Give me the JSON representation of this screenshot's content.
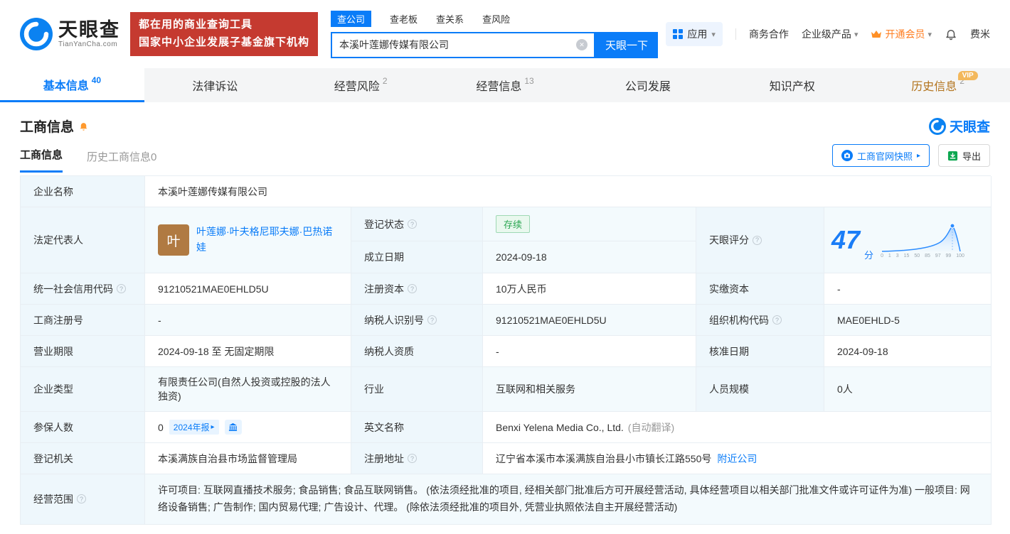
{
  "icons": {
    "caret_down": "▾",
    "arrow_right": "▸",
    "clear": "✕",
    "question": "?"
  },
  "header": {
    "brand": {
      "name": "天眼查",
      "domain": "TianYanCha.com"
    },
    "promo": {
      "line1": "都在用的商业查询工具",
      "line2": "国家中小企业发展子基金旗下机构"
    },
    "search": {
      "tabs": [
        {
          "label": "查公司"
        },
        {
          "label": "查老板"
        },
        {
          "label": "查关系"
        },
        {
          "label": "查风险"
        }
      ],
      "value": "本溪叶莲娜传媒有限公司",
      "button": "天眼一下"
    },
    "menu": {
      "apps": "应用",
      "cooperation": "商务合作",
      "enterprise": "企业级产品",
      "vip": "开通会员",
      "user": "费米"
    }
  },
  "nav_tabs": [
    {
      "label": "基本信息",
      "count": "40"
    },
    {
      "label": "法律诉讼",
      "count": ""
    },
    {
      "label": "经营风险",
      "count": "2"
    },
    {
      "label": "经营信息",
      "count": "13"
    },
    {
      "label": "公司发展",
      "count": ""
    },
    {
      "label": "知识产权",
      "count": ""
    },
    {
      "label": "历史信息",
      "count": "2",
      "vip": "VIP"
    }
  ],
  "section": {
    "title": "工商信息",
    "brand": "天眼查",
    "subtabs": [
      {
        "label": "工商信息"
      },
      {
        "label": "历史工商信息0"
      }
    ],
    "snapshot_button": "工商官网快照",
    "export_button": "导出"
  },
  "fields": {
    "company_name": {
      "label": "企业名称",
      "value": "本溪叶莲娜传媒有限公司"
    },
    "legal_rep": {
      "label": "法定代表人",
      "avatar": "叶",
      "value": "叶莲娜·叶夫格尼耶夫娜·巴热诺娃"
    },
    "reg_status": {
      "label": "登记状态",
      "value": "存续"
    },
    "establish_date": {
      "label": "成立日期",
      "value": "2024-09-18"
    },
    "score": {
      "label": "天眼评分",
      "value": "47",
      "unit": "分",
      "axis": [
        "0",
        "1",
        "3",
        "15",
        "50",
        "85",
        "97",
        "99",
        "100"
      ]
    },
    "credit_code": {
      "label": "统一社会信用代码",
      "value": "91210521MAE0EHLD5U"
    },
    "reg_capital": {
      "label": "注册资本",
      "value": "10万人民币"
    },
    "paid_capital": {
      "label": "实缴资本",
      "value": "-"
    },
    "reg_number": {
      "label": "工商注册号",
      "value": "-"
    },
    "taxpayer_id": {
      "label": "纳税人识别号",
      "value": "91210521MAE0EHLD5U"
    },
    "org_code": {
      "label": "组织机构代码",
      "value": "MAE0EHLD-5"
    },
    "business_term": {
      "label": "营业期限",
      "value": "2024-09-18 至 无固定期限"
    },
    "taxpayer_qualification": {
      "label": "纳税人资质",
      "value": "-"
    },
    "approval_date": {
      "label": "核准日期",
      "value": "2024-09-18"
    },
    "company_type": {
      "label": "企业类型",
      "value": "有限责任公司(自然人投资或控股的法人独资)"
    },
    "industry": {
      "label": "行业",
      "value": "互联网和相关服务"
    },
    "staff_size": {
      "label": "人员规模",
      "value": "0人"
    },
    "insured_count": {
      "label": "参保人数",
      "value": "0",
      "badge": "2024年报"
    },
    "english_name": {
      "label": "英文名称",
      "value": "Benxi Yelena Media Co., Ltd.",
      "note": "(自动翻译)"
    },
    "registry": {
      "label": "登记机关",
      "value": "本溪满族自治县市场监督管理局"
    },
    "address": {
      "label": "注册地址",
      "value": "辽宁省本溪市本溪满族自治县小市镇长江路550号",
      "link": "附近公司"
    },
    "business_scope": {
      "label": "经营范围",
      "value": "许可项目: 互联网直播技术服务; 食品销售; 食品互联网销售。 (依法须经批准的项目, 经相关部门批准后方可开展经营活动, 具体经营项目以相关部门批准文件或许可证件为准) 一般项目: 网络设备销售; 广告制作; 国内贸易代理; 广告设计、代理。 (除依法须经批准的项目外, 凭营业执照依法自主开展经营活动)"
    }
  }
}
